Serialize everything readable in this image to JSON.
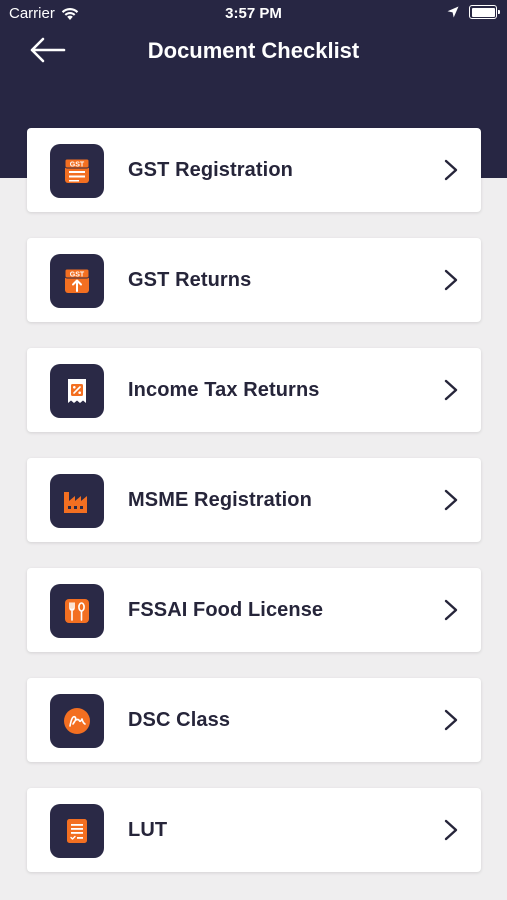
{
  "status_bar": {
    "carrier": "Carrier",
    "time": "3:57 PM",
    "icons": [
      "wifi-icon",
      "location-arrow-icon",
      "battery-icon"
    ]
  },
  "nav": {
    "back_icon": "arrow-left-icon",
    "title": "Document Checklist"
  },
  "colors": {
    "header_bg": "#272643",
    "page_bg": "#efeeef",
    "icon_tile_bg": "#2a2946",
    "icon_accent": "#f36f21",
    "text": "#26253a"
  },
  "items": [
    {
      "label": "GST Registration",
      "icon": "gst-registration-icon",
      "icon_text": "GST"
    },
    {
      "label": "GST Returns",
      "icon": "gst-returns-icon",
      "icon_text": "GST"
    },
    {
      "label": "Income Tax Returns",
      "icon": "income-tax-receipt-icon"
    },
    {
      "label": "MSME Registration",
      "icon": "factory-icon"
    },
    {
      "label": "FSSAI Food License",
      "icon": "fork-spoon-icon"
    },
    {
      "label": "DSC Class",
      "icon": "signature-icon"
    },
    {
      "label": "LUT",
      "icon": "document-icon"
    }
  ]
}
